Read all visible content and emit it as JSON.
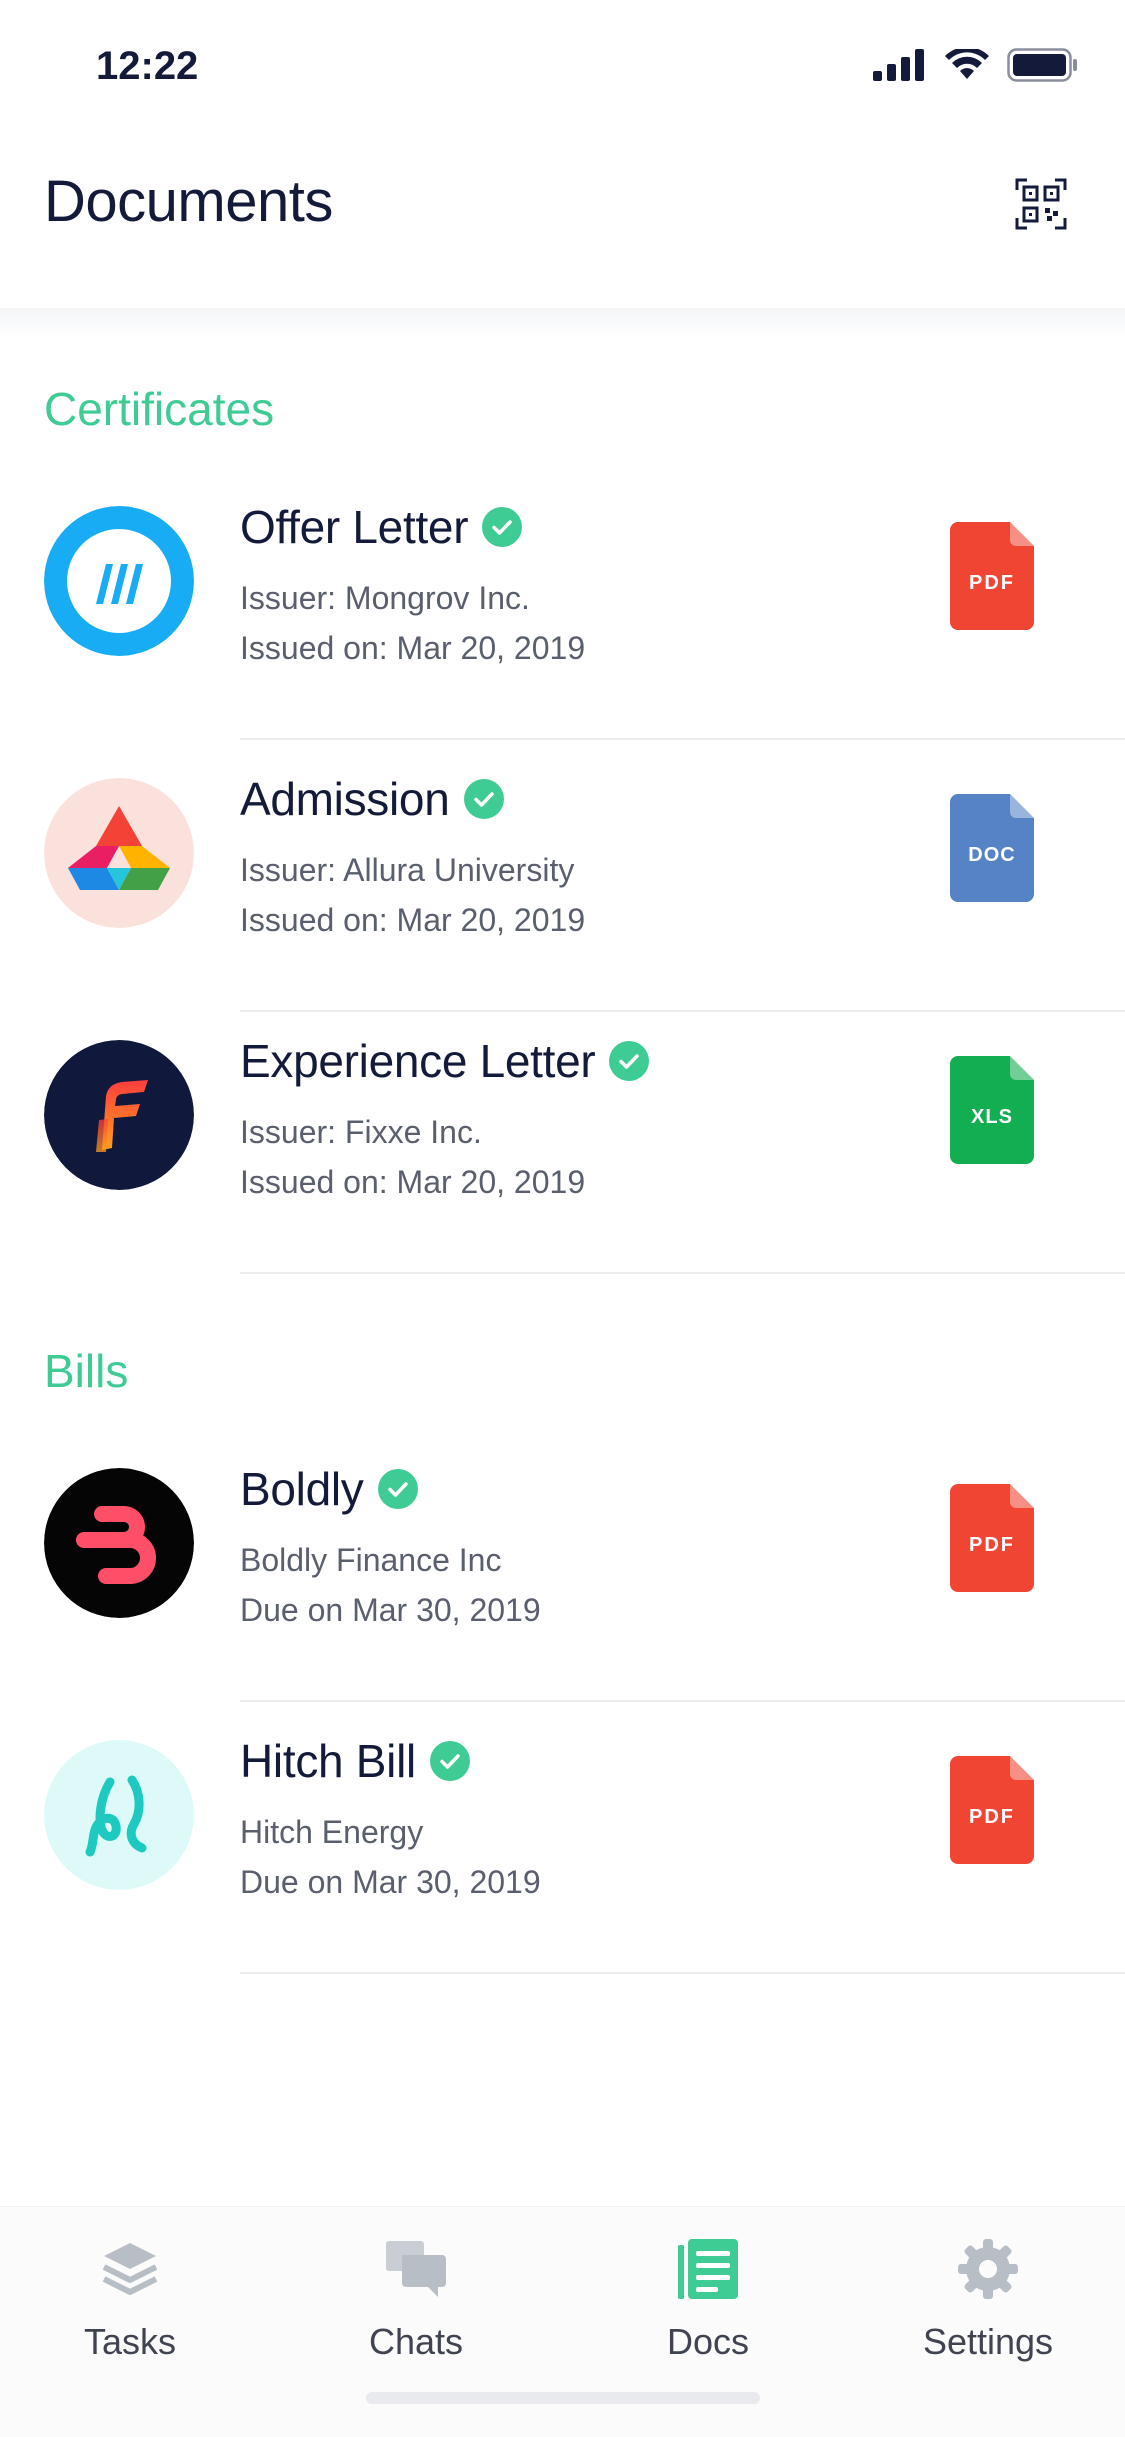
{
  "status_bar": {
    "time": "12:22"
  },
  "header": {
    "title": "Documents"
  },
  "sections": {
    "certificates": {
      "title": "Certificates"
    },
    "bills": {
      "title": "Bills"
    }
  },
  "documents": {
    "offer_letter": {
      "title": "Offer Letter",
      "line1": "Issuer: Mongrov Inc.",
      "line2": "Issued on: Mar 20, 2019",
      "file_type": "PDF",
      "file_color": "#f04533"
    },
    "admission": {
      "title": "Admission",
      "line1": "Issuer: Allura University",
      "line2": "Issued on: Mar 20, 2019",
      "file_type": "DOC",
      "file_color": "#5682c6"
    },
    "experience_letter": {
      "title": "Experience Letter",
      "line1": "Issuer: Fixxe Inc.",
      "line2": "Issued on: Mar 20, 2019",
      "file_type": "XLS",
      "file_color": "#13ad52"
    },
    "boldly": {
      "title": "Boldly",
      "line1": "Boldly Finance Inc",
      "line2": "Due on Mar 30, 2019",
      "file_type": "PDF",
      "file_color": "#f04533"
    },
    "hitch_bill": {
      "title": "Hitch Bill",
      "line1": "Hitch Energy",
      "line2": "Due on Mar 30, 2019",
      "file_type": "PDF",
      "file_color": "#f04533"
    }
  },
  "tabbar": {
    "tasks": "Tasks",
    "chats": "Chats",
    "docs": "Docs",
    "settings": "Settings"
  },
  "colors": {
    "accent": "#3fcb94",
    "text_primary": "#141b3a",
    "text_secondary": "#5a5f6d",
    "tab_inactive": "#b8bec6"
  },
  "icons": {
    "qr": "qr-code-icon",
    "verified": "verified-check-icon",
    "tasks": "layers-icon",
    "chats": "chat-bubbles-icon",
    "docs": "document-list-icon",
    "settings": "gear-icon"
  }
}
